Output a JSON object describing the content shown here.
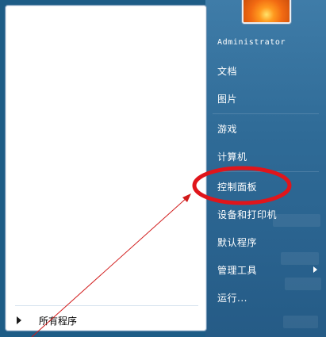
{
  "start_menu": {
    "left_pane": {
      "all_programs_label": "所有程序"
    },
    "right_pane": {
      "user_name": "Administrator",
      "items": [
        {
          "label": "文档"
        },
        {
          "label": "图片"
        },
        {
          "label": "游戏"
        },
        {
          "label": "计算机"
        },
        {
          "label": "控制面板"
        },
        {
          "label": "设备和打印机"
        },
        {
          "label": "默认程序"
        },
        {
          "label": "管理工具"
        },
        {
          "label": "运行..."
        }
      ]
    }
  },
  "annotation": {
    "highlight_color": "#e0151b",
    "arrow_color": "#d11a1a"
  },
  "icons": {
    "all_programs_arrow": "triangle-right",
    "admin_tools_submenu": "triangle-right"
  }
}
